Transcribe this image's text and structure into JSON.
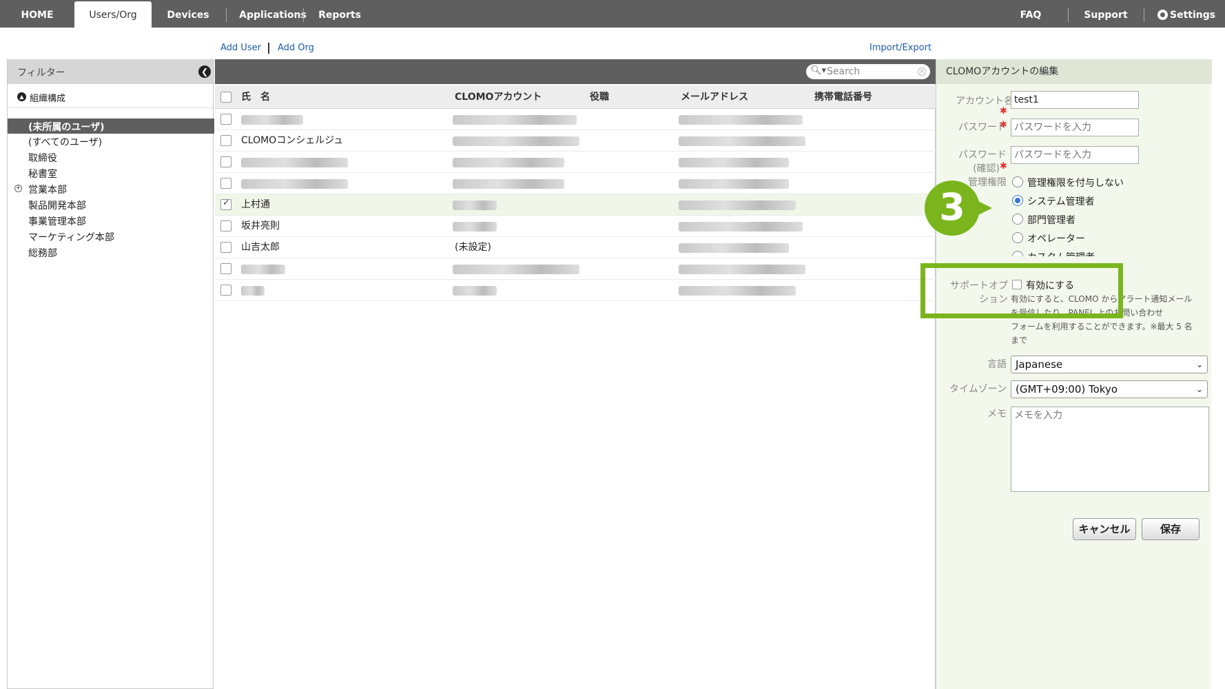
{
  "nav": {
    "tabs": [
      "HOME",
      "Users/Org",
      "Devices",
      "Applications",
      "Reports"
    ],
    "right": {
      "faq": "FAQ",
      "support": "Support",
      "settings": "Settings"
    }
  },
  "actions": {
    "add_user": "Add User",
    "add_org": "Add Org",
    "import_export": "Import/Export"
  },
  "sidebar": {
    "filter_label": "フィルター",
    "org_structure": "組織構成",
    "items": [
      "(未所属のユーザ)",
      "(すべてのユーザ)",
      "取締役",
      "秘書室",
      "営業本部",
      "製品開発本部",
      "事業管理本部",
      "マーケティング本部",
      "総務部"
    ]
  },
  "list": {
    "search_placeholder": "Search",
    "columns": [
      "氏　名",
      "CLOMOアカウント",
      "役職",
      "メールアドレス",
      "携帯電話番号"
    ],
    "rows": [
      {
        "name": "",
        "account": "",
        "checked": false
      },
      {
        "name": "CLOMOコンシェルジュ",
        "account": "",
        "checked": false
      },
      {
        "name": "",
        "account": "",
        "checked": false
      },
      {
        "name": "",
        "account": "",
        "checked": false
      },
      {
        "name": "上村通",
        "account": "",
        "checked": true
      },
      {
        "name": "坂井亮則",
        "account": "",
        "checked": false
      },
      {
        "name": "山吉太郎",
        "account": "(未設定)",
        "checked": false
      },
      {
        "name": "",
        "account": "",
        "checked": false
      },
      {
        "name": "",
        "account": "",
        "checked": false
      }
    ]
  },
  "edit": {
    "title": "CLOMOアカウントの編集",
    "account_label": "アカウント名",
    "account_value": "test1",
    "password_label": "パスワード",
    "password_placeholder": "パスワードを入力",
    "password_confirm_label_1": "パスワード",
    "password_confirm_label_2": "(確認)",
    "password_confirm_placeholder": "パスワードを入力",
    "admin_label": "管理権限",
    "admin_options": [
      "管理権限を付与しない",
      "システム管理者",
      "部門管理者",
      "オペレーター",
      "カスタム管理者"
    ],
    "admin_selected": 1,
    "support_label_1": "サポートオプ",
    "support_label_2": "ション",
    "support_checkbox": "有効にする",
    "support_help": [
      "有効にすると、CLOMO からアラート通知メール",
      "を受信したり、PANEL 上のお問い合わせ",
      "フォームを利用することができます。※最大 5 名",
      "まで"
    ],
    "language_label": "言語",
    "language_value": "Japanese",
    "timezone_label": "タイムゾーン",
    "timezone_value": "(GMT+09:00) Tokyo",
    "memo_label": "メモ",
    "memo_placeholder": "メモを入力",
    "cancel": "キャンセル",
    "save": "保存"
  },
  "annotation": {
    "step": "3",
    "color": "#7ab51d"
  }
}
